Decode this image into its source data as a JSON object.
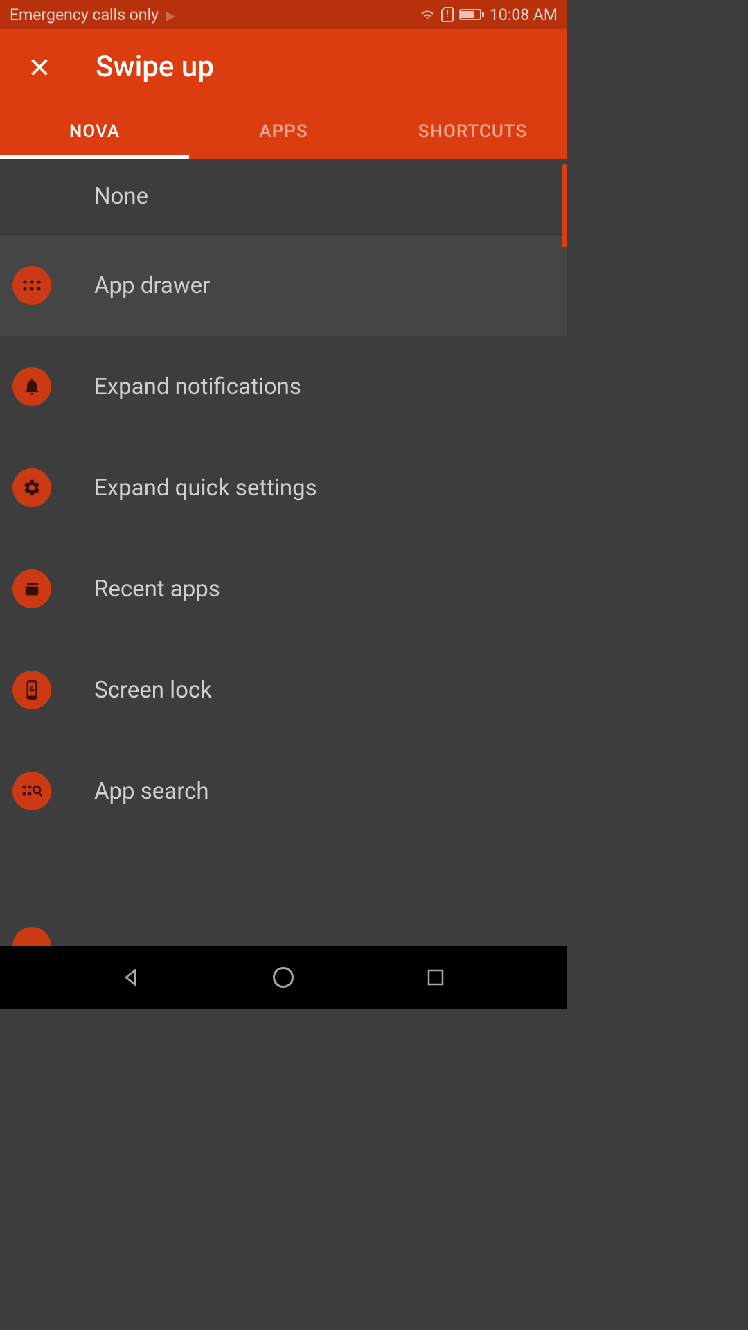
{
  "statusBar": {
    "leftText": "Emergency calls only",
    "time": "10:08 AM"
  },
  "header": {
    "title": "Swipe up"
  },
  "tabs": {
    "nova": "NOVA",
    "apps": "APPS",
    "shortcuts": "SHORTCUTS"
  },
  "items": {
    "none": "None",
    "appDrawer": "App drawer",
    "expandNotifications": "Expand notifications",
    "expandQuickSettings": "Expand quick settings",
    "recentApps": "Recent apps",
    "screenLock": "Screen lock",
    "appSearch": "App search"
  },
  "colors": {
    "accent": "#db3c10",
    "darkAccent": "#b8310d",
    "iconBg": "#cc3a13",
    "bg": "#3d3d3d"
  }
}
